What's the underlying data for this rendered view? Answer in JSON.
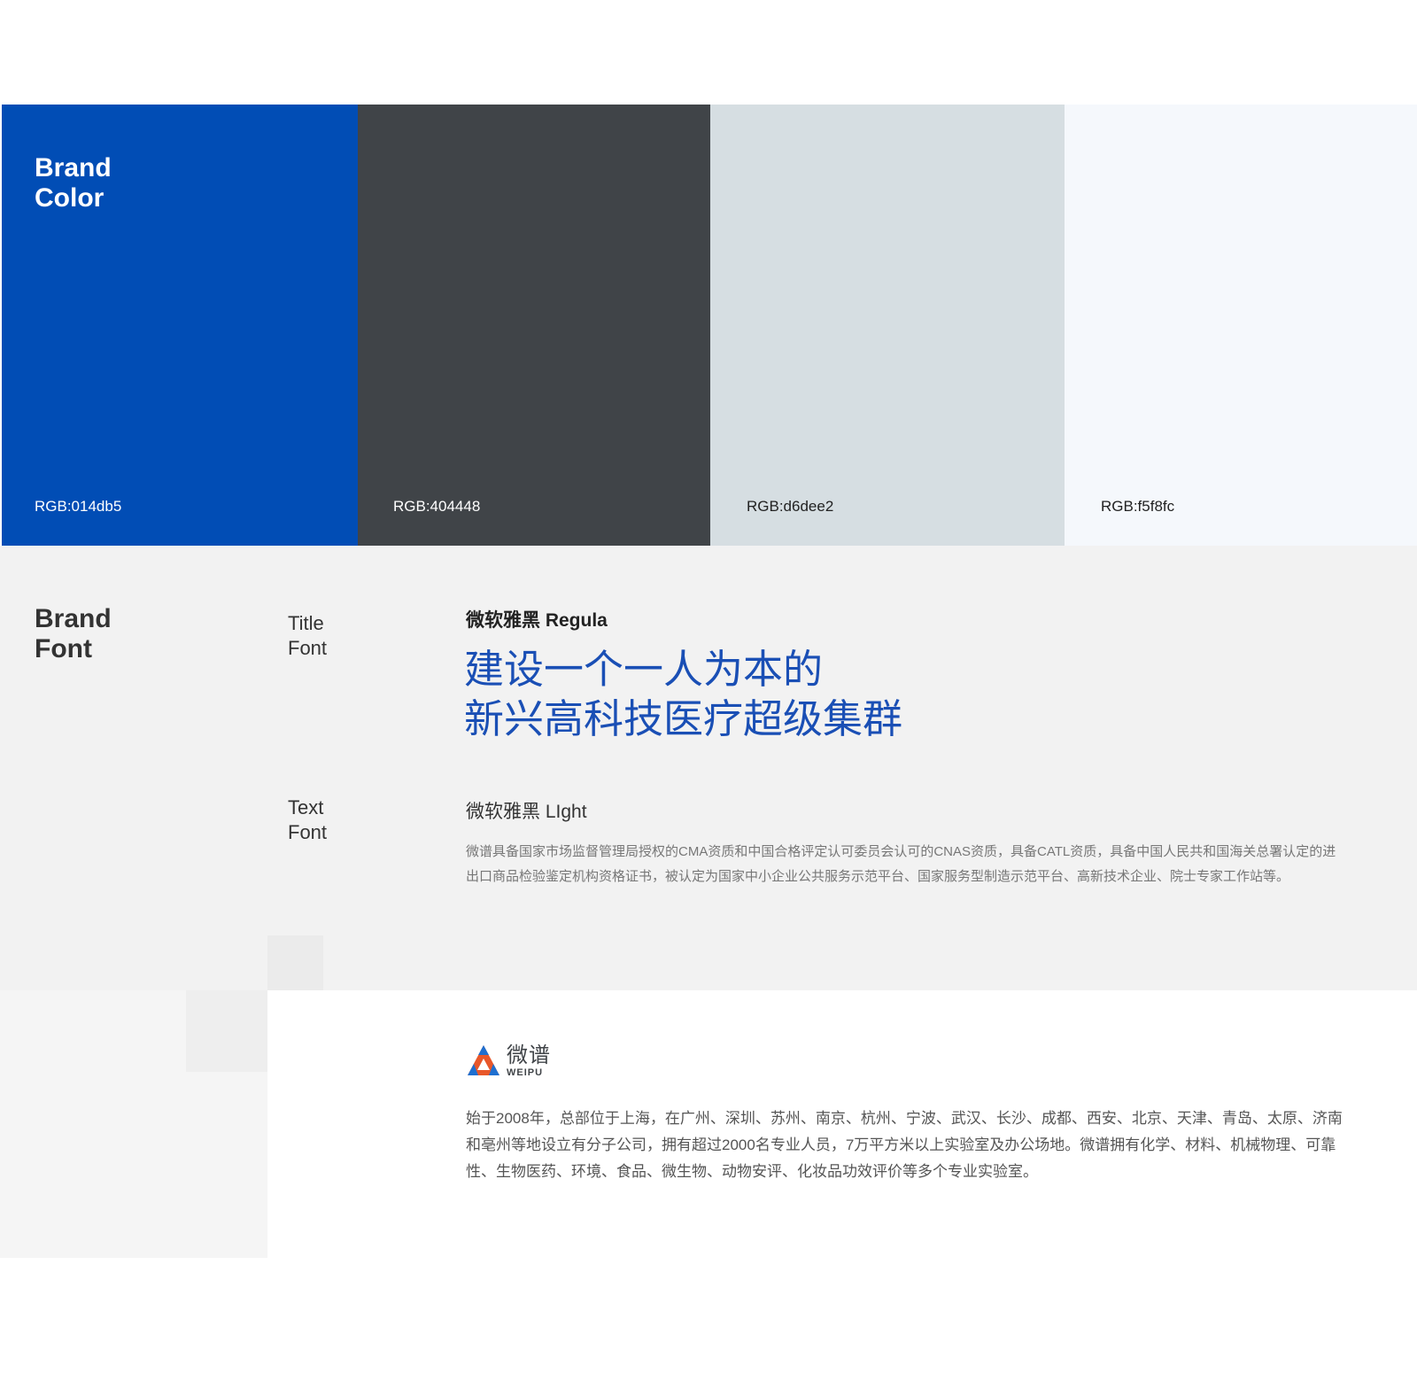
{
  "brand_color": {
    "title_line1": "Brand",
    "title_line2": "Color",
    "swatches": [
      {
        "code": "RGB:014db5",
        "color": "#014db5"
      },
      {
        "code": "RGB:404448",
        "color": "#404448"
      },
      {
        "code": "RGB:d6dee2",
        "color": "#d6dee2"
      },
      {
        "code": "RGB:f5f8fc",
        "color": "#f5f8fc"
      }
    ]
  },
  "brand_font": {
    "title_line1": "Brand",
    "title_line2": "Font",
    "title_font": {
      "label_line1": "Title",
      "label_line2": "Font",
      "name": "微软雅黑 Regula",
      "sample_line1": "建设一个一人为本的",
      "sample_line2": "新兴高科技医疗超级集群"
    },
    "text_font": {
      "label_line1": "Text",
      "label_line2": "Font",
      "name": "微软雅黑 LIght",
      "sample": "微谱具备国家市场监督管理局授权的CMA资质和中国合格评定认可委员会认可的CNAS资质，具备CATL资质，具备中国人民共和国海关总署认定的进出口商品检验鉴定机构资格证书，被认定为国家中小企业公共服务示范平台、国家服务型制造示范平台、高新技术企业、院士专家工作站等。"
    }
  },
  "logo": {
    "cn": "微谱",
    "en": "WEIPU",
    "icon": "triangle-logo-icon"
  },
  "company_desc": "始于2008年，总部位于上海，在广州、深圳、苏州、南京、杭州、宁波、武汉、长沙、成都、西安、北京、天津、青岛、太原、济南和亳州等地设立有分子公司，拥有超过2000名专业人员，7万平方米以上实验室及办公场地。微谱拥有化学、材料、机械物理、可靠性、生物医药、环境、食品、微生物、动物安评、化妆品功效评价等多个专业实验室。",
  "colors": {
    "accent": "#014db5",
    "dark": "#404448",
    "title_sample": "#1a4fb5",
    "logo_orange": "#e8572a",
    "logo_blue": "#1e6fd0"
  }
}
